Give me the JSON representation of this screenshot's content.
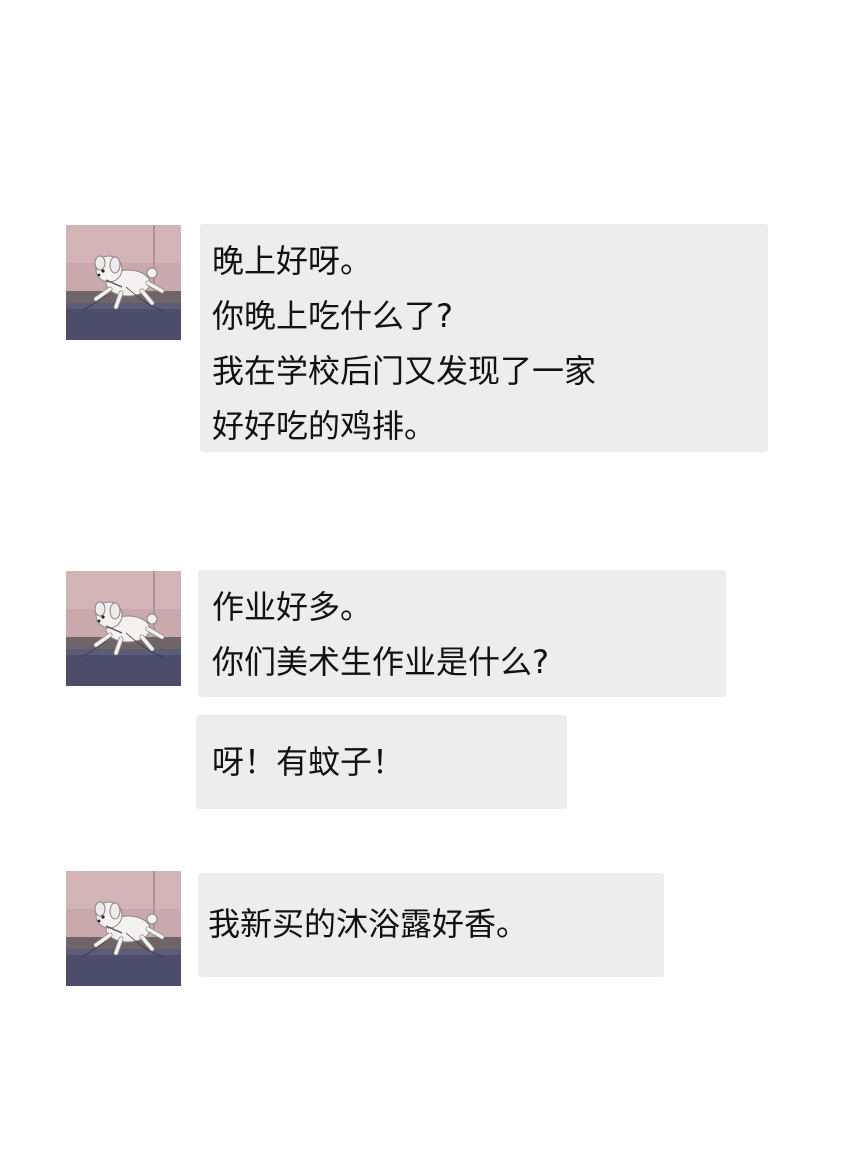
{
  "chat": {
    "messages": [
      {
        "lines": [
          "晚上好呀。",
          "你晚上吃什么了?",
          "我在学校后门又发现了一家",
          "好好吃的鸡排。"
        ]
      },
      {
        "lines": [
          "作业好多。",
          "你们美术生作业是什么?"
        ]
      },
      {
        "lines": [
          "呀！有蚊子！"
        ]
      },
      {
        "lines": [
          "我新买的沐浴露好香。"
        ]
      }
    ],
    "avatar": {
      "icon": "white-puppy-running-avatar",
      "colors": {
        "wall": "#c9a9ac",
        "floor": "#4b4d6b",
        "baseboard": "#6f6468",
        "dog": "#f4f2f0"
      }
    },
    "colors": {
      "background": "#ffffff",
      "bubble": "#ededed",
      "text": "#111111"
    }
  }
}
